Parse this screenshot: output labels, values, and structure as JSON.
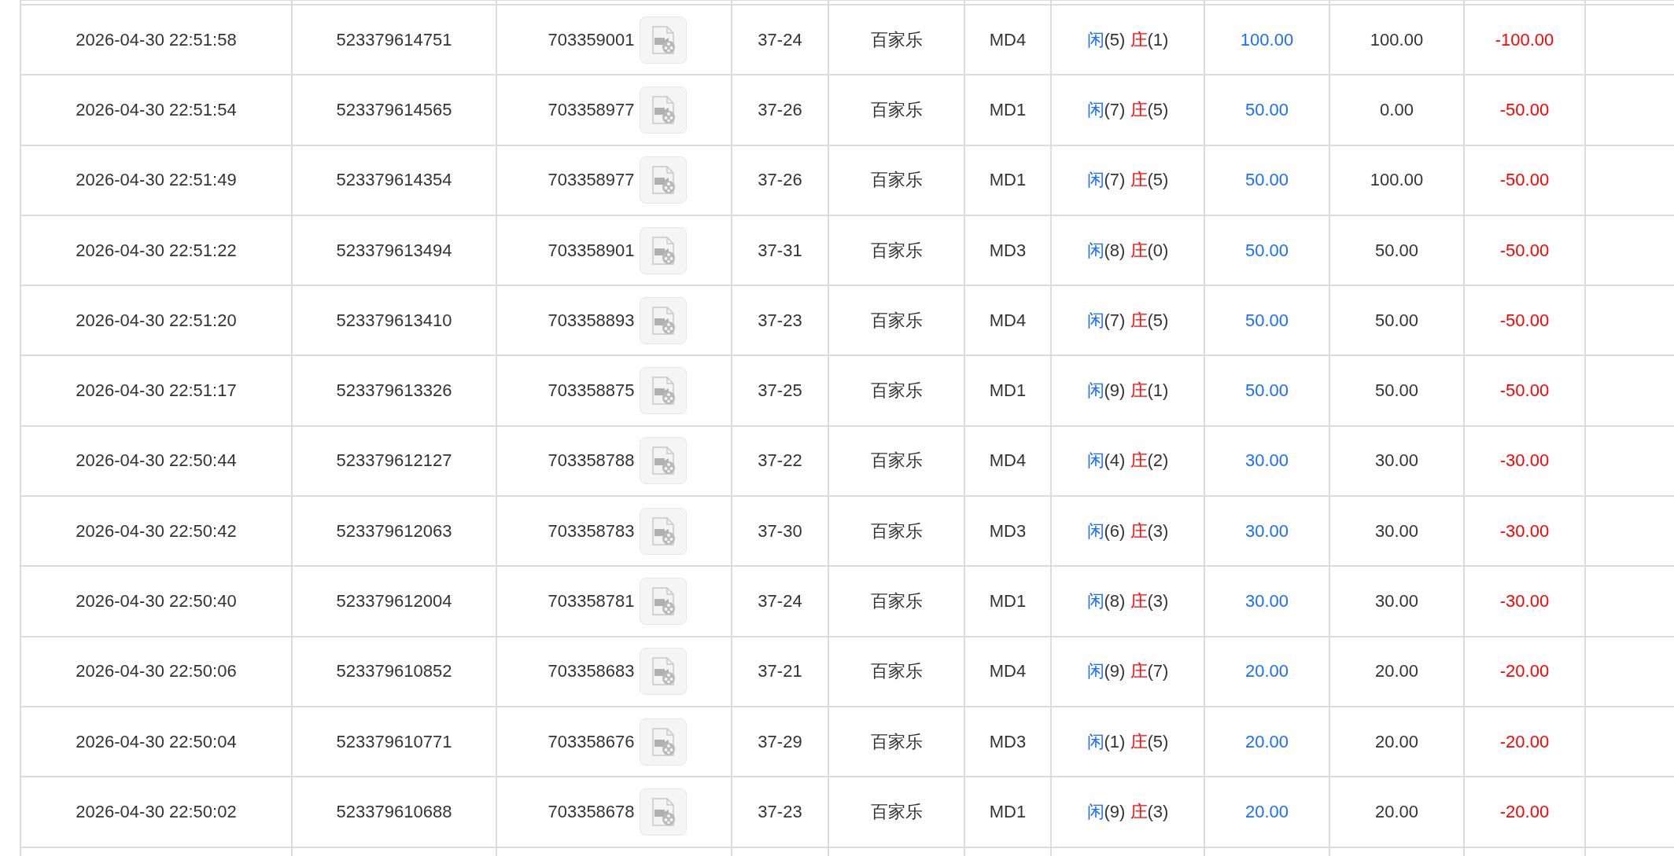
{
  "rows": [
    {
      "column_1": "2026-04-30 22:51:58",
      "column_2": "523379614751",
      "column_3": "703359001",
      "column_4": "37-24",
      "column_5": "百家乐",
      "column_6": "MD4",
      "column_7": {
        "player": "闲",
        "player_points": "(5)",
        "banker": "庄",
        "banker_points": "(1)"
      },
      "column_8": "100.00",
      "column_9": "100.00",
      "column_10": "-100.00"
    },
    {
      "column_1": "2026-04-30 22:51:54",
      "column_2": "523379614565",
      "column_3": "703358977",
      "column_4": "37-26",
      "column_5": "百家乐",
      "column_6": "MD1",
      "column_7": {
        "player": "闲",
        "player_points": "(7)",
        "banker": "庄",
        "banker_points": "(5)"
      },
      "column_8": "50.00",
      "column_9": "0.00",
      "column_10": "-50.00"
    },
    {
      "column_1": "2026-04-30 22:51:49",
      "column_2": "523379614354",
      "column_3": "703358977",
      "column_4": "37-26",
      "column_5": "百家乐",
      "column_6": "MD1",
      "column_7": {
        "player": "闲",
        "player_points": "(7)",
        "banker": "庄",
        "banker_points": "(5)"
      },
      "column_8": "50.00",
      "column_9": "100.00",
      "column_10": "-50.00"
    },
    {
      "column_1": "2026-04-30 22:51:22",
      "column_2": "523379613494",
      "column_3": "703358901",
      "column_4": "37-31",
      "column_5": "百家乐",
      "column_6": "MD3",
      "column_7": {
        "player": "闲",
        "player_points": "(8)",
        "banker": "庄",
        "banker_points": "(0)"
      },
      "column_8": "50.00",
      "column_9": "50.00",
      "column_10": "-50.00"
    },
    {
      "column_1": "2026-04-30 22:51:20",
      "column_2": "523379613410",
      "column_3": "703358893",
      "column_4": "37-23",
      "column_5": "百家乐",
      "column_6": "MD4",
      "column_7": {
        "player": "闲",
        "player_points": "(7)",
        "banker": "庄",
        "banker_points": "(5)"
      },
      "column_8": "50.00",
      "column_9": "50.00",
      "column_10": "-50.00"
    },
    {
      "column_1": "2026-04-30 22:51:17",
      "column_2": "523379613326",
      "column_3": "703358875",
      "column_4": "37-25",
      "column_5": "百家乐",
      "column_6": "MD1",
      "column_7": {
        "player": "闲",
        "player_points": "(9)",
        "banker": "庄",
        "banker_points": "(1)"
      },
      "column_8": "50.00",
      "column_9": "50.00",
      "column_10": "-50.00"
    },
    {
      "column_1": "2026-04-30 22:50:44",
      "column_2": "523379612127",
      "column_3": "703358788",
      "column_4": "37-22",
      "column_5": "百家乐",
      "column_6": "MD4",
      "column_7": {
        "player": "闲",
        "player_points": "(4)",
        "banker": "庄",
        "banker_points": "(2)"
      },
      "column_8": "30.00",
      "column_9": "30.00",
      "column_10": "-30.00"
    },
    {
      "column_1": "2026-04-30 22:50:42",
      "column_2": "523379612063",
      "column_3": "703358783",
      "column_4": "37-30",
      "column_5": "百家乐",
      "column_6": "MD3",
      "column_7": {
        "player": "闲",
        "player_points": "(6)",
        "banker": "庄",
        "banker_points": "(3)"
      },
      "column_8": "30.00",
      "column_9": "30.00",
      "column_10": "-30.00"
    },
    {
      "column_1": "2026-04-30 22:50:40",
      "column_2": "523379612004",
      "column_3": "703358781",
      "column_4": "37-24",
      "column_5": "百家乐",
      "column_6": "MD1",
      "column_7": {
        "player": "闲",
        "player_points": "(8)",
        "banker": "庄",
        "banker_points": "(3)"
      },
      "column_8": "30.00",
      "column_9": "30.00",
      "column_10": "-30.00"
    },
    {
      "column_1": "2026-04-30 22:50:06",
      "column_2": "523379610852",
      "column_3": "703358683",
      "column_4": "37-21",
      "column_5": "百家乐",
      "column_6": "MD4",
      "column_7": {
        "player": "闲",
        "player_points": "(9)",
        "banker": "庄",
        "banker_points": "(7)"
      },
      "column_8": "20.00",
      "column_9": "20.00",
      "column_10": "-20.00"
    },
    {
      "column_1": "2026-04-30 22:50:04",
      "column_2": "523379610771",
      "column_3": "703358676",
      "column_4": "37-29",
      "column_5": "百家乐",
      "column_6": "MD3",
      "column_7": {
        "player": "闲",
        "player_points": "(1)",
        "banker": "庄",
        "banker_points": "(5)"
      },
      "column_8": "20.00",
      "column_9": "20.00",
      "column_10": "-20.00"
    },
    {
      "column_1": "2026-04-30 22:50:02",
      "column_2": "523379610688",
      "column_3": "703358678",
      "column_4": "37-23",
      "column_5": "百家乐",
      "column_6": "MD1",
      "column_7": {
        "player": "闲",
        "player_points": "(9)",
        "banker": "庄",
        "banker_points": "(3)"
      },
      "column_8": "20.00",
      "column_9": "20.00",
      "column_10": "-20.00"
    }
  ]
}
